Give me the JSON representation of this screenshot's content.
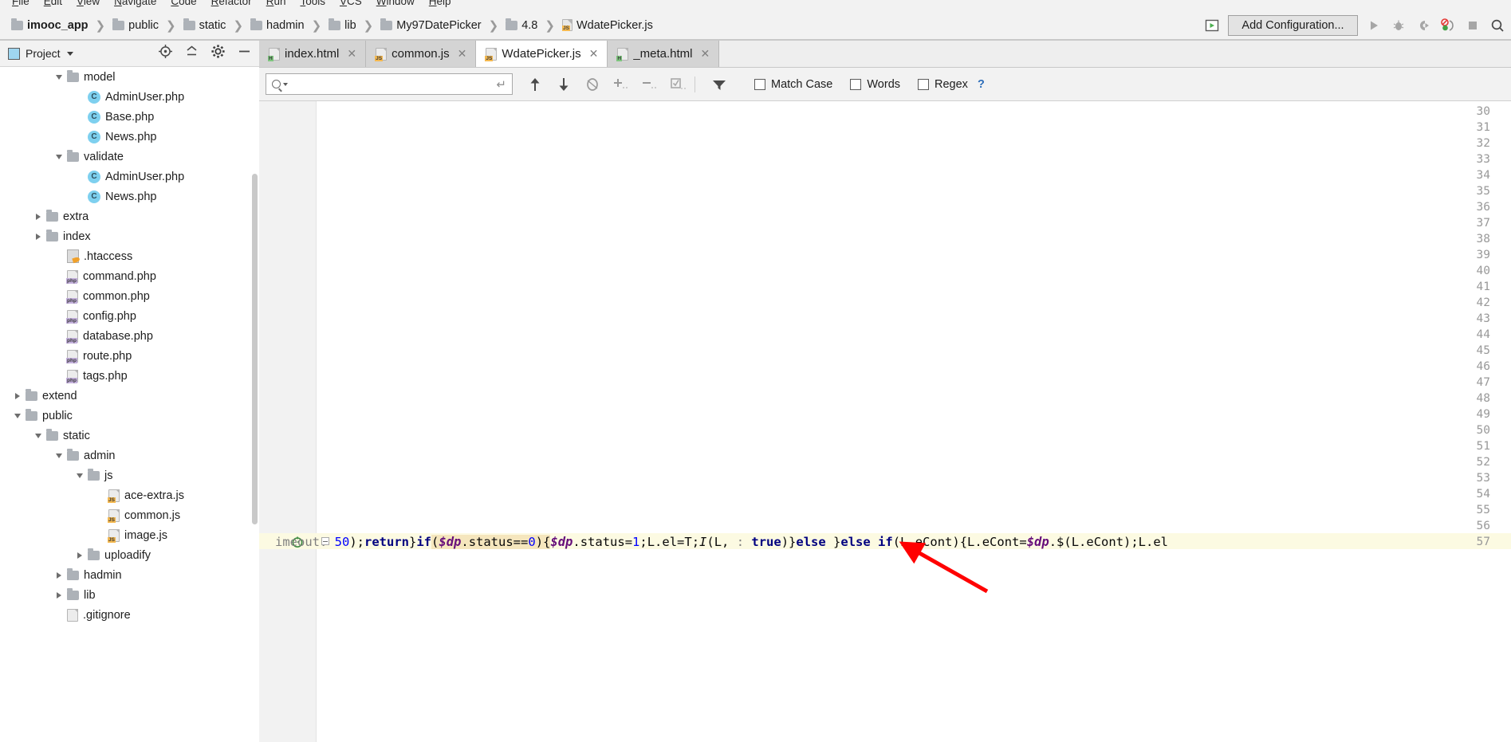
{
  "menu": {
    "items": [
      "File",
      "Edit",
      "View",
      "Navigate",
      "Code",
      "Refactor",
      "Run",
      "Tools",
      "VCS",
      "Window",
      "Help"
    ]
  },
  "breadcrumb": {
    "items": [
      {
        "label": "imooc_app",
        "icon": "folder-icon",
        "bold": true
      },
      {
        "label": "public",
        "icon": "folder-icon",
        "bold": false
      },
      {
        "label": "static",
        "icon": "folder-icon",
        "bold": false
      },
      {
        "label": "hadmin",
        "icon": "folder-icon",
        "bold": false
      },
      {
        "label": "lib",
        "icon": "folder-icon",
        "bold": false
      },
      {
        "label": "My97DatePicker",
        "icon": "folder-icon",
        "bold": false
      },
      {
        "label": "4.8",
        "icon": "folder-icon",
        "bold": false
      },
      {
        "label": "WdatePicker.js",
        "icon": "js-file-icon",
        "bold": false
      }
    ],
    "separator": "❯"
  },
  "toolbar": {
    "run_anything_icon": "run-anything-icon",
    "add_configuration_label": "Add Configuration...",
    "icons": [
      "run-icon",
      "debug-icon",
      "run-coverage-icon",
      "profiler-icon",
      "stop-icon",
      "search-everywhere-icon"
    ]
  },
  "project_panel": {
    "title": "Project",
    "caret": "chevron-down-icon",
    "tools": [
      "locate-icon",
      "collapse-all-icon",
      "settings-gear-icon",
      "hide-icon"
    ]
  },
  "tree": [
    {
      "label": "model",
      "type": "folder",
      "depth": 3,
      "twisty": "down"
    },
    {
      "label": "AdminUser.php",
      "type": "class",
      "depth": 4,
      "twisty": "none"
    },
    {
      "label": "Base.php",
      "type": "class",
      "depth": 4,
      "twisty": "none"
    },
    {
      "label": "News.php",
      "type": "class",
      "depth": 4,
      "twisty": "none"
    },
    {
      "label": "validate",
      "type": "folder",
      "depth": 3,
      "twisty": "down"
    },
    {
      "label": "AdminUser.php",
      "type": "class",
      "depth": 4,
      "twisty": "none"
    },
    {
      "label": "News.php",
      "type": "class",
      "depth": 4,
      "twisty": "none"
    },
    {
      "label": "extra",
      "type": "folder",
      "depth": 2,
      "twisty": "right"
    },
    {
      "label": "index",
      "type": "folder",
      "depth": 2,
      "twisty": "right"
    },
    {
      "label": ".htaccess",
      "type": "htaccess",
      "depth": 3,
      "twisty": "none"
    },
    {
      "label": "command.php",
      "type": "php",
      "depth": 3,
      "twisty": "none"
    },
    {
      "label": "common.php",
      "type": "php",
      "depth": 3,
      "twisty": "none"
    },
    {
      "label": "config.php",
      "type": "php",
      "depth": 3,
      "twisty": "none"
    },
    {
      "label": "database.php",
      "type": "php",
      "depth": 3,
      "twisty": "none"
    },
    {
      "label": "route.php",
      "type": "php",
      "depth": 3,
      "twisty": "none"
    },
    {
      "label": "tags.php",
      "type": "php",
      "depth": 3,
      "twisty": "none"
    },
    {
      "label": "extend",
      "type": "folder",
      "depth": 1,
      "twisty": "right"
    },
    {
      "label": "public",
      "type": "folder",
      "depth": 1,
      "twisty": "down"
    },
    {
      "label": "static",
      "type": "folder",
      "depth": 2,
      "twisty": "down"
    },
    {
      "label": "admin",
      "type": "folder",
      "depth": 3,
      "twisty": "down"
    },
    {
      "label": "js",
      "type": "folder",
      "depth": 4,
      "twisty": "down"
    },
    {
      "label": "ace-extra.js",
      "type": "js",
      "depth": 5,
      "twisty": "none"
    },
    {
      "label": "common.js",
      "type": "js",
      "depth": 5,
      "twisty": "none"
    },
    {
      "label": "image.js",
      "type": "js",
      "depth": 5,
      "twisty": "none"
    },
    {
      "label": "uploadify",
      "type": "folder",
      "depth": 4,
      "twisty": "right"
    },
    {
      "label": "hadmin",
      "type": "folder",
      "depth": 3,
      "twisty": "right"
    },
    {
      "label": "lib",
      "type": "folder",
      "depth": 3,
      "twisty": "right"
    },
    {
      "label": ".gitignore",
      "type": "plain",
      "depth": 3,
      "twisty": "none"
    }
  ],
  "tabs": [
    {
      "label": "index.html",
      "icon": "html-file-icon",
      "active": false
    },
    {
      "label": "common.js",
      "icon": "js-file-icon",
      "active": false
    },
    {
      "label": "WdatePicker.js",
      "icon": "js-file-icon",
      "active": true
    },
    {
      "label": "_meta.html",
      "icon": "html-file-icon",
      "active": false
    }
  ],
  "find": {
    "placeholder": "",
    "value": "",
    "search_icon": "search-icon",
    "enter_icon": "enter-key-icon",
    "buttons": [
      "find-previous-icon",
      "find-next-icon",
      "select-all-occurrences-icon",
      "add-line-icon",
      "remove-line-icon",
      "select-all-icon",
      "filter-icon"
    ],
    "options": [
      {
        "label": "Match Case",
        "checked": false
      },
      {
        "label": "Words",
        "checked": false
      },
      {
        "label": "Regex",
        "checked": false
      }
    ],
    "help_label": "?"
  },
  "editor": {
    "line_numbers": [
      "30",
      "31",
      "32",
      "33",
      "34",
      "35",
      "36",
      "37",
      "38",
      "39",
      "40",
      "41",
      "42",
      "43",
      "44",
      "45",
      "46",
      "47",
      "48",
      "49",
      "50",
      "51",
      "52",
      "53",
      "54",
      "55",
      "56",
      "57"
    ],
    "current_line": "57",
    "run_gutter_icon": "run-test-icon",
    "fold_icon": "fold-collapse-icon",
    "code": {
      "param_hint": "imeout:",
      "segments": [
        {
          "t": " 50",
          "c": "num"
        },
        {
          "t": ");",
          "c": "plain"
        },
        {
          "t": "return",
          "c": "k"
        },
        {
          "t": "}",
          "c": "plain"
        },
        {
          "t": "if",
          "c": "k"
        },
        {
          "t": "(",
          "c": "plain"
        },
        {
          "t": "$dp",
          "c": "var"
        },
        {
          "t": ".status==",
          "c": "plain"
        },
        {
          "t": "0",
          "c": "num"
        },
        {
          "t": "){",
          "c": "plain"
        },
        {
          "t": "$dp",
          "c": "var"
        },
        {
          "t": ".status=",
          "c": "plain"
        },
        {
          "t": "1",
          "c": "num"
        },
        {
          "t": ";L.el=T;",
          "c": "plain"
        },
        {
          "t": "I",
          "c": "ital"
        },
        {
          "t": "(L, ",
          "c": "plain"
        },
        {
          "t": ": ",
          "c": "param"
        },
        {
          "t": "true",
          "c": "k"
        },
        {
          "t": ")}",
          "c": "plain"
        },
        {
          "t": "else",
          "c": "k"
        },
        {
          "t": " }",
          "c": "plain"
        },
        {
          "t": "else",
          "c": "k"
        },
        {
          "t": " ",
          "c": "plain"
        },
        {
          "t": "if",
          "c": "k"
        },
        {
          "t": "(L.eCont){L.eCont=",
          "c": "plain"
        },
        {
          "t": "$dp",
          "c": "var"
        },
        {
          "t": ".$(L.eCont);L.el",
          "c": "plain"
        }
      ]
    }
  },
  "annotation": {
    "arrow_color": "#ff0000",
    "arrow_name": "red-pointer-arrow"
  }
}
